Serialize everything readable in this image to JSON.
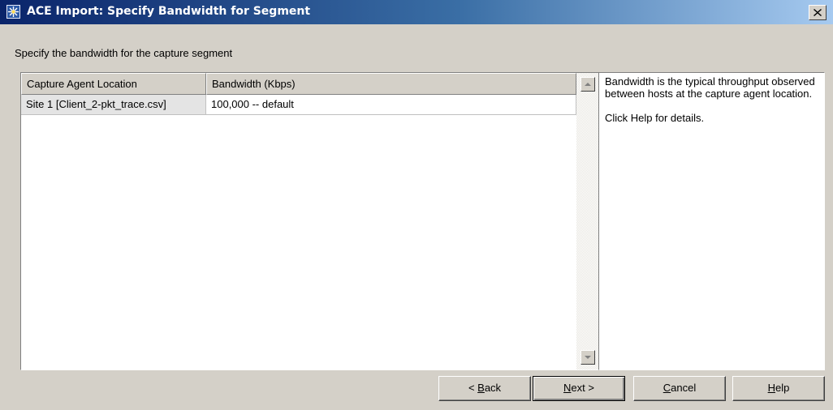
{
  "window": {
    "title": "ACE Import: Specify Bandwidth for Segment",
    "icon": "ace-star-icon",
    "close_icon": "close-icon"
  },
  "prompt": "Specify the bandwidth for the capture segment",
  "grid": {
    "columns": [
      "Capture Agent Location",
      "Bandwidth (Kbps)"
    ],
    "rows": [
      {
        "location": "Site 1 [Client_2-pkt_trace.csv]",
        "bandwidth": "100,000 -- default"
      }
    ]
  },
  "help": {
    "paragraphs": [
      "Bandwidth is the typical throughput observed between hosts at the capture agent location.",
      "Click Help for details."
    ]
  },
  "buttons": {
    "back": {
      "prefix": "< ",
      "mnemonic": "B",
      "rest": "ack"
    },
    "next": {
      "mnemonic": "N",
      "rest": "ext >"
    },
    "cancel": {
      "mnemonic": "C",
      "rest": "ancel"
    },
    "help": {
      "mnemonic": "H",
      "rest": "elp"
    }
  },
  "colors": {
    "title_start": "#0a246a",
    "title_end": "#a6caf0",
    "face": "#d4d0c8"
  }
}
